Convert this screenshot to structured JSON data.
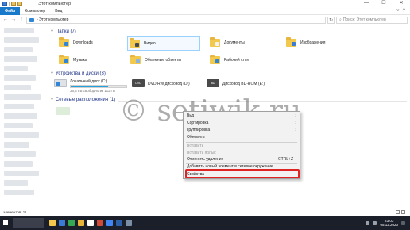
{
  "window": {
    "title": "Этот компьютер",
    "minimize": "—",
    "maximize": "☐",
    "close": "✕"
  },
  "ribbon": {
    "tabs": [
      "Файл",
      "Компьютер",
      "Вид"
    ],
    "right_icons": [
      "˅",
      "?"
    ]
  },
  "address": {
    "back": "←",
    "forward": "→",
    "up": "↑",
    "path": "› Этот компьютер",
    "refresh": "↻",
    "search_placeholder": "Поиск: Этот компьютер"
  },
  "sections": {
    "folders": "Папки (7)",
    "drives": "Устройства и диски (3)",
    "network": "Сетевые расположения (1)"
  },
  "folders": [
    {
      "name": "Downloads",
      "badge_color": "#2f86d6"
    },
    {
      "name": "Видео",
      "badge_color": "#404a58"
    },
    {
      "name": "Документы",
      "badge_color": "#f2f2f2"
    },
    {
      "name": "Изображения",
      "badge_color": "#3a7bd5"
    },
    {
      "name": "Музыка",
      "badge_color": "#2f86d6"
    },
    {
      "name": "Объемные объекты",
      "badge_color": "#8fb3e0"
    },
    {
      "name": "Рабочий стол",
      "badge_color": "#2f86d6"
    }
  ],
  "drives": [
    {
      "name": "Локальный диск (C:)",
      "sub": "36,4 ГБ свободно из 111 ГБ",
      "used_fraction": 0.67
    },
    {
      "name": "DVD RW дисковод (D:)",
      "label": "DVD"
    },
    {
      "name": "Дисковод BD-ROM (E:)",
      "label": "BD"
    }
  ],
  "watermark": "© setiwik.ru",
  "context_menu": [
    {
      "label": "Вид",
      "arrow": "›",
      "disabled": false
    },
    {
      "label": "Сортировка",
      "arrow": "›",
      "disabled": false
    },
    {
      "label": "Группировка",
      "arrow": "›",
      "disabled": false
    },
    {
      "label": "Обновить",
      "disabled": false
    },
    {
      "label": "Вставить",
      "disabled": true
    },
    {
      "label": "Вставить ярлык",
      "disabled": true
    },
    {
      "label": "Отменить удаление",
      "shortcut": "CTRL+Z",
      "disabled": false
    },
    {
      "label": "Добавить новый элемент в сетевое окружение",
      "disabled": false
    },
    {
      "label": "Свойства",
      "disabled": false
    }
  ],
  "status": {
    "items": "элементов: 11"
  },
  "taskbar": {
    "time": "23:03",
    "date": "05.12.2020",
    "app_colors": [
      "#f2c94c",
      "#3a7bd5",
      "#34a853",
      "#e8b339",
      "#ffffff",
      "#d04a3a",
      "#4285f4",
      "#2b5fa8",
      "#7a8fa6"
    ]
  },
  "colors": {
    "accent": "#1979ca",
    "highlight": "#e02424"
  }
}
